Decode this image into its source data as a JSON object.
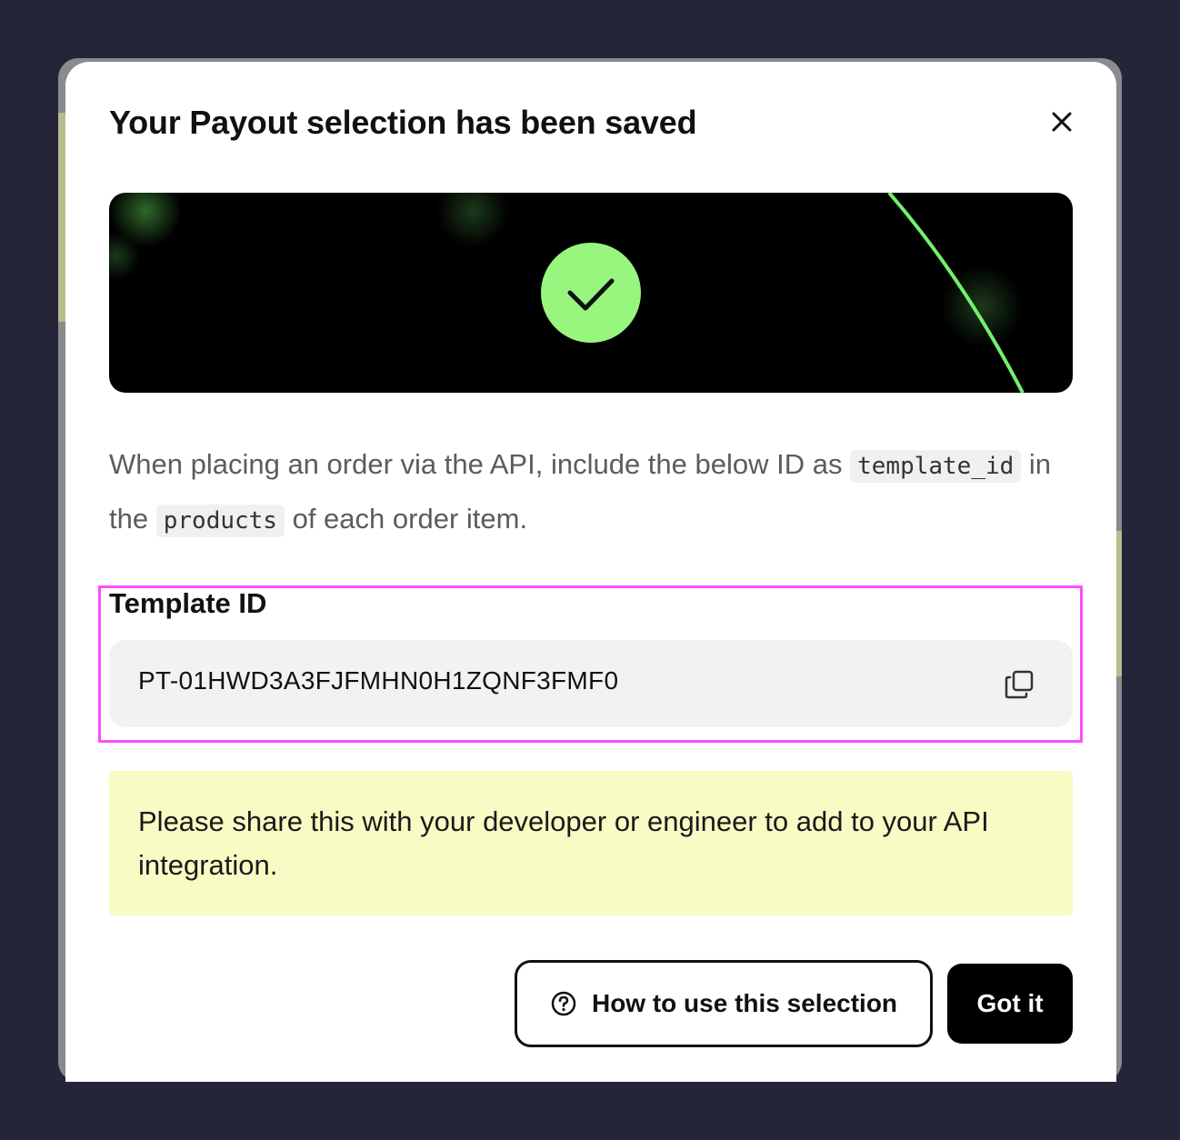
{
  "modal": {
    "title": "Your Payout selection has been saved",
    "close_icon": "close-icon",
    "hero": {
      "icon": "check-circle-icon",
      "accent_color": "#98f57d",
      "background_color": "#000000"
    },
    "instructions": {
      "line_start": "When placing an order via the API, include the below ID as",
      "code_template_id": "template_id",
      "middle": "in the",
      "code_products": "products",
      "end": "of each order item."
    },
    "template_id": {
      "label": "Template ID",
      "value": "PT-01HWD3A3FJFMHN0H1ZQNF3FMF0",
      "copy_icon": "copy-icon"
    },
    "notice": {
      "text": "Please share this with your developer or engineer to add to your API integration."
    },
    "buttons": {
      "help_label": "How to use this selection",
      "help_icon": "question-circle-icon",
      "confirm_label": "Got it"
    }
  },
  "colors": {
    "highlight_border": "#ff4dff",
    "notice_background": "#f7fbc4",
    "page_background": "#25253a"
  }
}
